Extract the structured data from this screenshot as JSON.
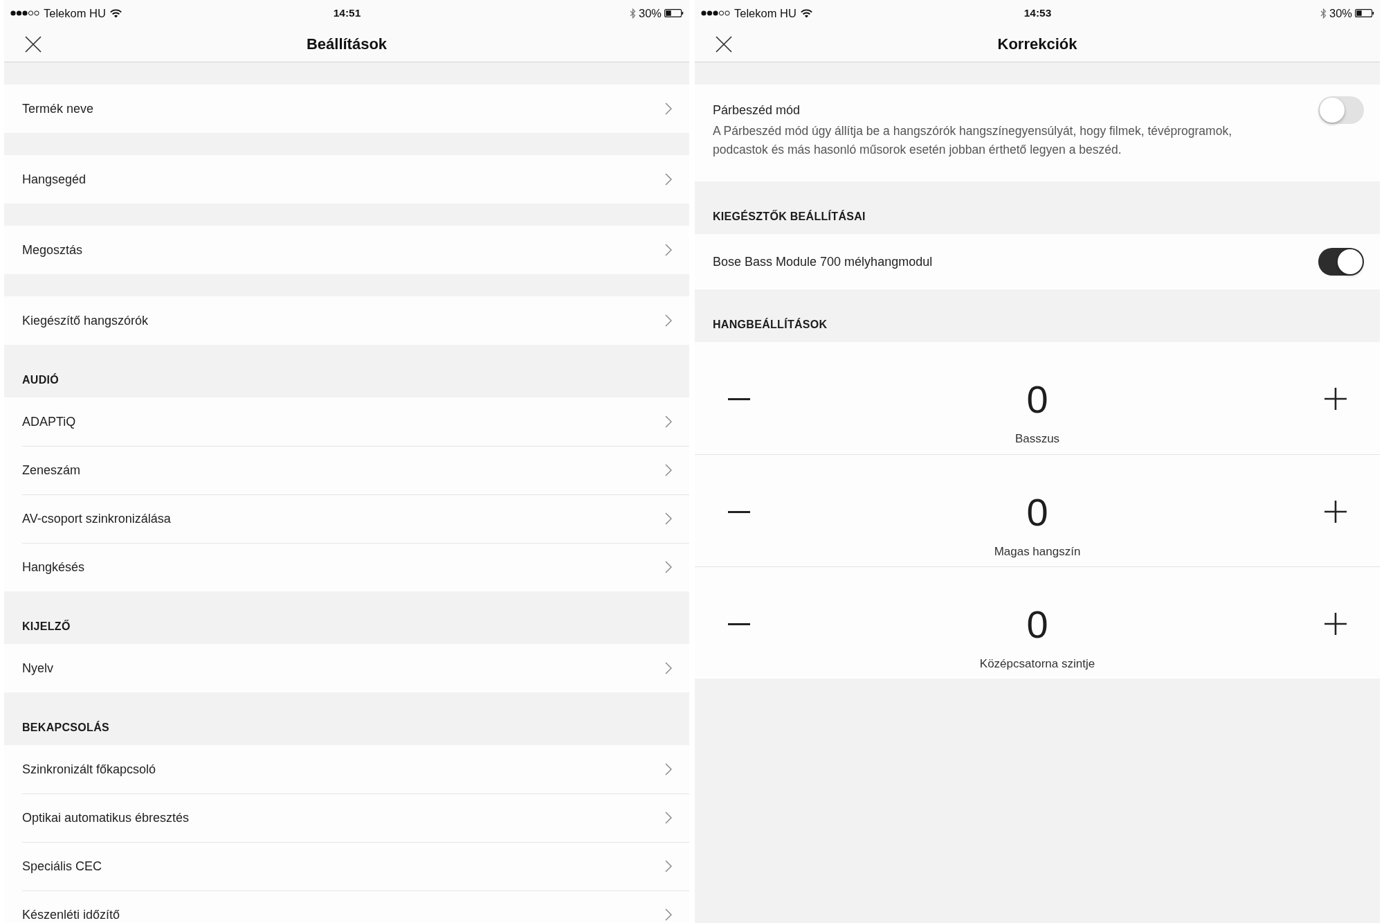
{
  "screens": [
    {
      "status_bar": {
        "carrier": "Telekom HU",
        "time": "14:51",
        "battery": "30%"
      },
      "title": "Beállítások",
      "sections": [
        {
          "rows": [
            {
              "kind": "link",
              "label": "Termék neve"
            }
          ]
        },
        {
          "rows": [
            {
              "kind": "link",
              "label": "Hangsegéd"
            }
          ]
        },
        {
          "rows": [
            {
              "kind": "link",
              "label": "Megosztás"
            }
          ]
        },
        {
          "rows": [
            {
              "kind": "link",
              "label": "Kiegészítő hangszórók"
            }
          ]
        },
        {
          "header": "AUDIÓ",
          "rows": [
            {
              "kind": "link",
              "label": "ADAPTiQ"
            },
            {
              "kind": "link",
              "label": "Zeneszám"
            },
            {
              "kind": "link",
              "label": "AV-csoport szinkronizálása"
            },
            {
              "kind": "link",
              "label": "Hangkésés"
            }
          ]
        },
        {
          "header": "KIJELZŐ",
          "rows": [
            {
              "kind": "link",
              "label": "Nyelv"
            }
          ]
        },
        {
          "header": "BEKAPCSOLÁS",
          "rows": [
            {
              "kind": "link",
              "label": "Szinkronizált főkapcsoló"
            },
            {
              "kind": "link",
              "label": "Optikai automatikus ébresztés"
            },
            {
              "kind": "link",
              "label": "Speciális CEC"
            },
            {
              "kind": "link",
              "label": "Készenléti időzítő"
            }
          ]
        }
      ]
    },
    {
      "status_bar": {
        "carrier": "Telekom HU",
        "time": "14:53",
        "battery": "30%"
      },
      "title": "Korrekciók",
      "sections": [
        {
          "rows": [
            {
              "kind": "toggle",
              "label": "Párbeszéd mód",
              "description": "A Párbeszéd mód úgy állítja be a hangszórók hangszínegyensúlyát, hogy filmek, tévéprogramok, podcastok és más hasonló műsorok esetén jobban érthető legyen a beszéd.",
              "on": false
            }
          ]
        },
        {
          "header": "KIEGÉSZTŐK BEÁLLÍTÁSAI",
          "rows": [
            {
              "kind": "toggle",
              "label": "Bose Bass Module 700 mélyhangmodul",
              "on": true
            }
          ]
        },
        {
          "header": "HANGBEÁLLÍTÁSOK",
          "rows": [
            {
              "kind": "stepper",
              "value": "0",
              "label": "Basszus"
            },
            {
              "kind": "stepper",
              "value": "0",
              "label": "Magas hangszín"
            },
            {
              "kind": "stepper",
              "value": "0",
              "label": "Középcsatorna szintje"
            }
          ]
        }
      ]
    }
  ]
}
